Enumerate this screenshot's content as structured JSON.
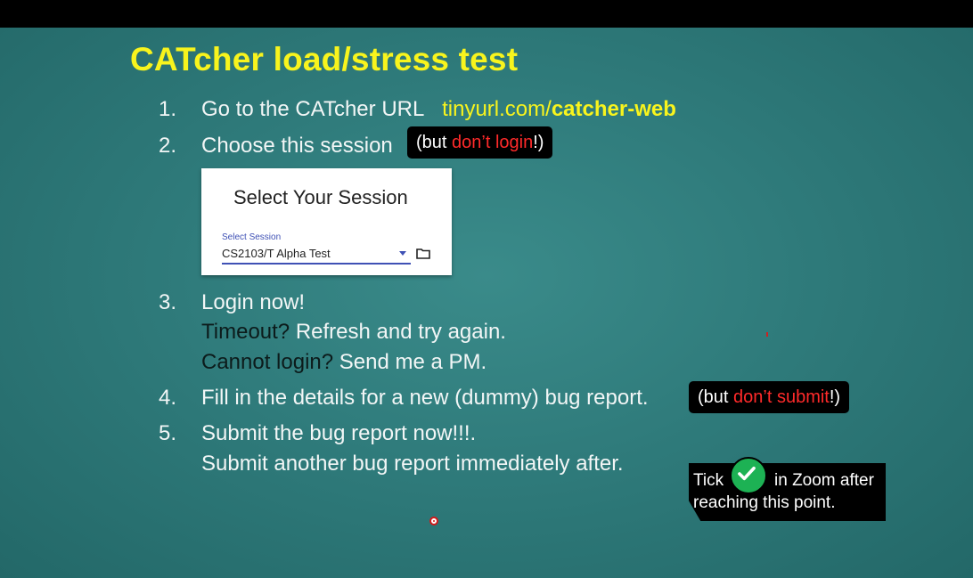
{
  "slide": {
    "title": "CATcher load/stress test",
    "steps": [
      {
        "number": "1.",
        "text": "Go to the CATcher URL",
        "url_prefix": "tinyurl.com/",
        "url_bold": "catcher-web"
      },
      {
        "number": "2.",
        "text": "Choose this session",
        "note_open": "(but ",
        "note_red": "don’t login",
        "note_close": "!)"
      },
      {
        "number": "3.",
        "text": "Login now!",
        "sub1_dark": "Timeout?",
        "sub1_rest": " Refresh and try again.",
        "sub2_dark": "Cannot login?",
        "sub2_rest": " Send me a PM."
      },
      {
        "number": "4.",
        "text": "Fill in the details for a new (dummy) bug report.",
        "note_open": "(but ",
        "note_red": "don’t submit",
        "note_close": "!)"
      },
      {
        "number": "5.",
        "text": "Submit the bug report now!!!.",
        "sub1": "Submit another bug report immediately after."
      }
    ],
    "session_card": {
      "title": "Select Your Session",
      "field_label": "Select Session",
      "field_value": "CS2103/T Alpha Test"
    },
    "callout": {
      "part1": "Tick",
      "part2": "in Zoom after",
      "part3": "reaching this point."
    }
  },
  "colors": {
    "title": "#f8f41d",
    "background": "#2f7b7b",
    "warning_red": "#ff2a2a",
    "tick_green": "#1db254"
  }
}
